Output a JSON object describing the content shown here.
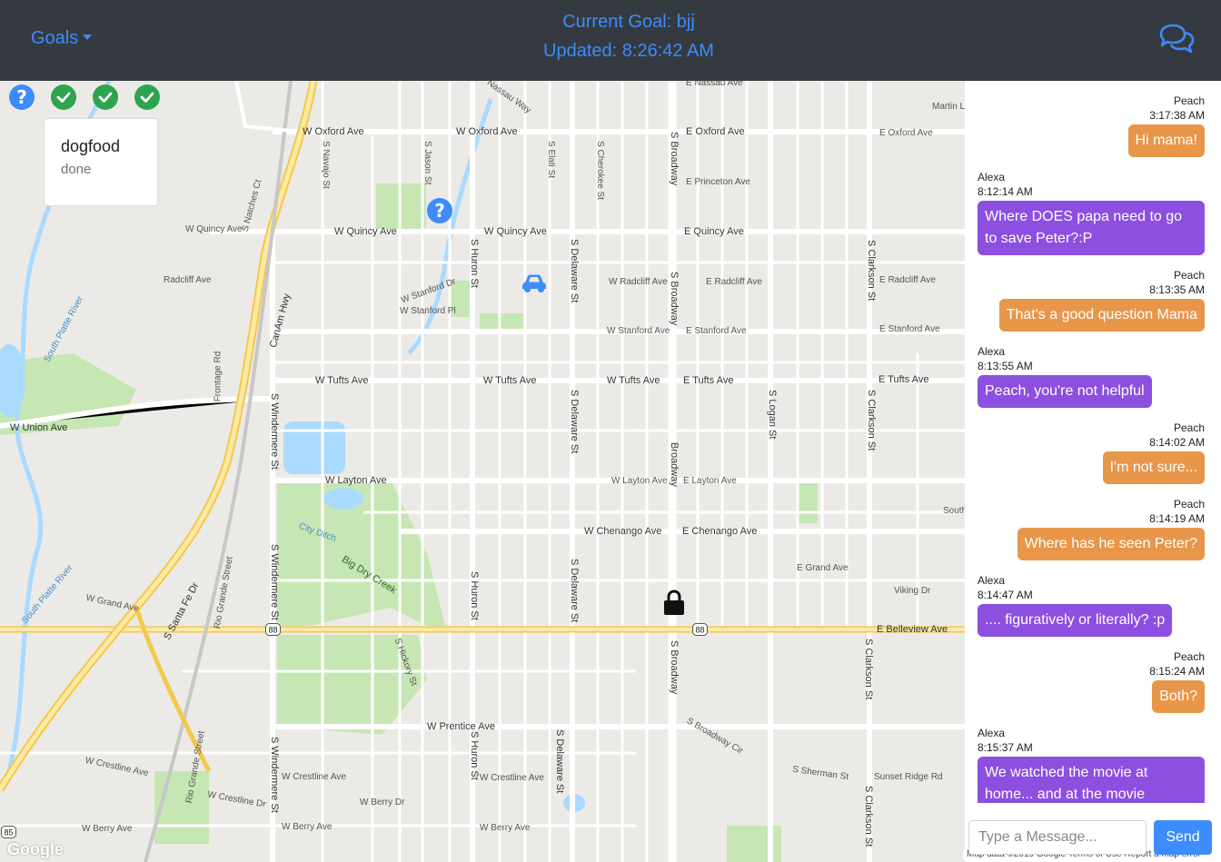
{
  "header": {
    "goals_label": "Goals",
    "current_goal": "Current Goal: bjj",
    "updated": "Updated: 8:26:42 AM"
  },
  "goal_status_icons": [
    "question-icon",
    "check-icon",
    "check-icon",
    "check-icon"
  ],
  "goal_card": {
    "name": "dogfood",
    "status": "done"
  },
  "map": {
    "streets": {
      "w_oxford_ave_1": "W Oxford Ave",
      "w_oxford_ave_2": "W Oxford Ave",
      "e_oxford_ave": "E Oxford Ave",
      "e_oxford_ave_small": "E Oxford Ave",
      "e_princeton_ave": "E Princeton Ave",
      "w_quincy_ave_small": "W Quincy Ave",
      "w_quincy_ave_1": "W Quincy Ave",
      "w_quincy_ave_2": "W Quincy Ave",
      "e_quincy_ave": "E Quincy Ave",
      "radcliff_ave": "Radcliff Ave",
      "w_radcliff_ave": "W Radcliff Ave",
      "e_radcliff_ave": "E Radcliff Ave",
      "e_radcliff_ave_2": "E Radcliff Ave",
      "w_stanford_dr": "W Stanford Dr",
      "w_stanford_pl": "W Stanford Pl",
      "w_stanford_ave": "W Stanford Ave",
      "e_stanford_ave": "E Stanford Ave",
      "e_stanford_ave_2": "E Stanford Ave",
      "w_tufts_ave_1": "W Tufts Ave",
      "w_tufts_ave_2": "W Tufts Ave",
      "w_tufts_ave_3": "W Tufts Ave",
      "e_tufts_ave_1": "E Tufts Ave",
      "e_tufts_ave_2": "E Tufts Ave",
      "w_union_ave": "W Union Ave",
      "w_layton_ave_1": "W Layton Ave",
      "w_layton_ave_2": "W Layton Ave",
      "e_layton_ave": "E Layton Ave",
      "w_chenango_ave": "W Chenango Ave",
      "e_chenango_ave": "E Chenango Ave",
      "e_grand_ave": "E Grand Ave",
      "w_grand_ave": "W Grand Ave",
      "e_belleview_ave": "E Belleview Ave",
      "w_prentice_ave": "W Prentice Ave",
      "w_crestline_ave_1": "W Crestline Ave",
      "w_crestline_ave_2": "W Crestline Ave",
      "w_crestline_ave_3": "W Crestline Ave",
      "w_crestline_dr": "W Crestline Dr",
      "w_berry_ave_1": "W Berry Ave",
      "w_berry_ave_2": "W Berry Ave",
      "w_berry_ave_3": "W Berry Ave",
      "w_berry_dr": "W Berry Dr",
      "s_sherman_st": "S Sherman St",
      "sunset_ridge_rd": "Sunset Ridge Rd",
      "viking_dr": "Viking Dr",
      "s_broadway_cir": "S Broadway Cir",
      "canam_hwy": "CanAm Hwy",
      "s_santa_fe_dr": "S Santa Fe Dr",
      "rio_grande_street_1": "Rio Grande Street",
      "rio_grande_street_2": "Rio Grande Street",
      "frontage_rd": "Frontage Rd",
      "south_platte_river_1": "South Platte River",
      "south_platte_river_2": "South Platte River",
      "big_dry_creek": "Big Dry Creek",
      "city_ditch": "City Ditch",
      "s_broadway_1": "S Broadway",
      "s_broadway_2": "S Broadway",
      "broadway": "Broadway",
      "s_broadway_3": "S Broadway",
      "s_huron_st_1": "S Huron St",
      "s_huron_st_2": "S Huron St",
      "s_huron_st_3": "S Huron St",
      "s_delaware_st_1": "S Delaware St",
      "s_delaware_st_2": "S Delaware St",
      "s_delaware_st_3": "S Delaware St",
      "s_delaware_st_4": "S Delaware St",
      "s_clarkson_st_1": "S Clarkson St",
      "s_clarkson_st_2": "S Clarkson St",
      "s_clarkson_st_3": "S Clarkson St",
      "s_clarkson_st_4": "S Clarkson St",
      "s_windermere_st_1": "S Windermere St",
      "s_windermere_st_2": "S Windermere St",
      "s_windermere_st_3": "S Windermere St",
      "s_logan_st": "S Logan St",
      "s_navajo_st": "S Navajo St",
      "s_elati_st": "S Elati St",
      "s_cherokee_st": "S Cherokee St",
      "s_jason_st": "S Jason St",
      "s_hickory_st": "S Hickory St",
      "s_natches_ct": "S Natches Ct",
      "nassau_way": "Nassau Way",
      "e_nassau_ave": "E Nassau Ave",
      "martin_ln": "Martin Ln",
      "south": "South"
    },
    "highway_shield": "88",
    "highway_shield_2": "88",
    "highway_shield_3": "85",
    "google_logo": "Google",
    "attribution": "Map data ©2019 Google   Terms of Use   Report a map error"
  },
  "chat": {
    "messages": [
      {
        "sender": "Peach",
        "time": "3:17:38 AM",
        "text": "Hi mama!",
        "side": "right"
      },
      {
        "sender": "Alexa",
        "time": "8:12:14 AM",
        "text": "Where DOES papa need to go to save Peter?:P",
        "side": "left"
      },
      {
        "sender": "Peach",
        "time": "8:13:35 AM",
        "text": "That's a good question Mama",
        "side": "right"
      },
      {
        "sender": "Alexa",
        "time": "8:13:55 AM",
        "text": "Peach, you're not helpful",
        "side": "left"
      },
      {
        "sender": "Peach",
        "time": "8:14:02 AM",
        "text": "I'm not sure...",
        "side": "right"
      },
      {
        "sender": "Peach",
        "time": "8:14:19 AM",
        "text": "Where has he seen Peter?",
        "side": "right"
      },
      {
        "sender": "Alexa",
        "time": "8:14:47 AM",
        "text": ".... figuratively or literally? :p",
        "side": "left"
      },
      {
        "sender": "Peach",
        "time": "8:15:24 AM",
        "text": "Both?",
        "side": "right"
      },
      {
        "sender": "Alexa",
        "time": "8:15:37 AM",
        "text": "We watched the movie at home... and at the movie",
        "side": "left"
      }
    ],
    "input_placeholder": "Type a Message...",
    "send_label": "Send"
  },
  "colors": {
    "header_bg": "#343a40",
    "accent_blue": "#3d8bfd",
    "peach_bubble": "#e8964a",
    "alexa_bubble": "#8d4fe0",
    "check_green": "#2ea44f"
  }
}
